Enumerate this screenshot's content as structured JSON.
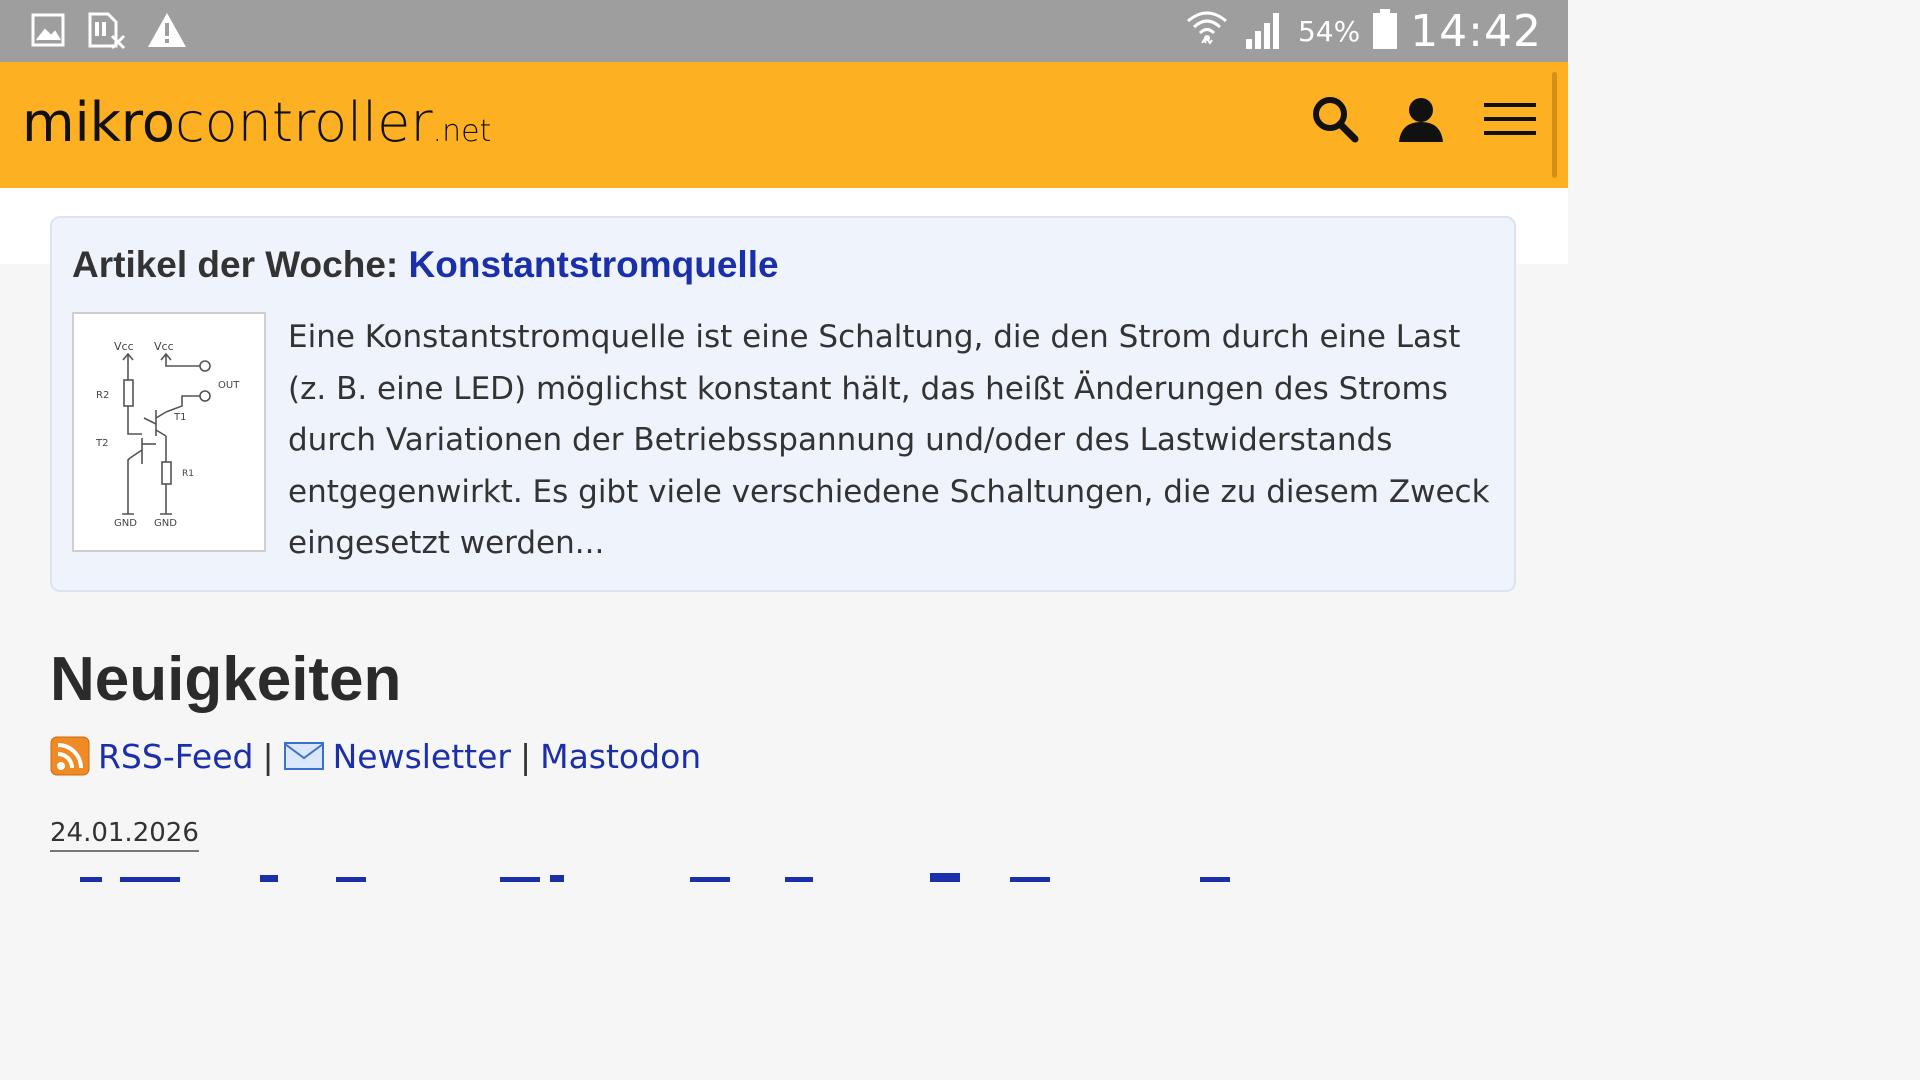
{
  "status_bar": {
    "battery_percent": "54%",
    "time": "14:42",
    "left_icons": [
      "gallery-icon",
      "storage-off-icon",
      "warning-icon"
    ],
    "right_icons": [
      "wifi-icon",
      "cell-signal-icon",
      "battery-icon"
    ]
  },
  "header": {
    "logo": {
      "part1": "mikro",
      "part2": "controller",
      "part3": ".net"
    },
    "icons": [
      "search-icon",
      "user-icon",
      "menu-icon"
    ],
    "background": "#fdb021"
  },
  "featured": {
    "title_prefix": "Artikel der Woche:",
    "title_link": "Konstantstromquelle",
    "text": "Eine Konstantstromquelle ist eine Schaltung, die den Strom durch eine Last (z. B. eine LED) möglichst konstant hält, das heißt Änderungen des Stroms durch Variationen der Betriebsspannung und/oder des Lastwiderstands entgegenwirkt. Es gibt viele verschiedene Schaltungen, die zu diesem Zweck eingesetzt werden...",
    "diagram_labels": {
      "vcc1": "Vcc",
      "vcc2": "Vcc",
      "out": "OUT",
      "r2": "R2",
      "t1": "T1",
      "t2": "T2",
      "r1": "R1",
      "gnd1": "GND",
      "gnd2": "GND"
    }
  },
  "news": {
    "heading": "Neuigkeiten",
    "rss_label": "RSS-Feed",
    "separator": "|",
    "newsletter_label": "Newsletter",
    "mastodon_label": "Mastodon",
    "date": "24.01.2026"
  },
  "colors": {
    "link": "#1a2fa8",
    "card_bg": "#eef3fc",
    "status_bar": "#9e9e9e"
  }
}
